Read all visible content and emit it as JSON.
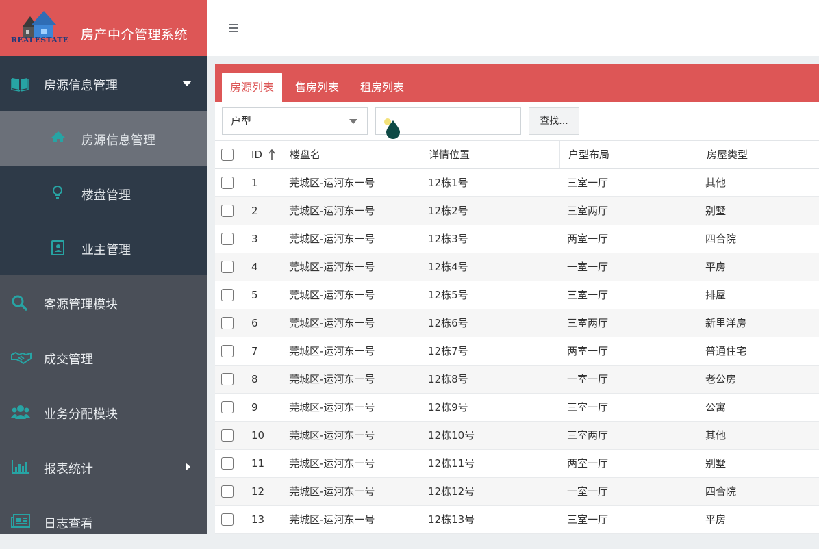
{
  "app": {
    "title": "房产中介管理系统",
    "logo_text": "REALESTATE"
  },
  "sidebar": {
    "items": [
      {
        "label": "房源信息管理",
        "icon": "book-icon",
        "expanded": true
      },
      {
        "label": "房源信息管理",
        "icon": "home-icon",
        "sub": true,
        "active": true
      },
      {
        "label": "楼盘管理",
        "icon": "lightbulb-icon",
        "sub": true
      },
      {
        "label": "业主管理",
        "icon": "contact-card-icon",
        "sub": true
      },
      {
        "label": "客源管理模块",
        "icon": "search-icon"
      },
      {
        "label": "成交管理",
        "icon": "handshake-icon"
      },
      {
        "label": "业务分配模块",
        "icon": "users-icon"
      },
      {
        "label": "报表统计",
        "icon": "bar-chart-icon",
        "has_children": true
      },
      {
        "label": "日志查看",
        "icon": "newspaper-icon"
      }
    ]
  },
  "tabs": [
    {
      "label": "房源列表",
      "active": true
    },
    {
      "label": "售房列表"
    },
    {
      "label": "租房列表"
    }
  ],
  "filter": {
    "select_value": "户型",
    "search_value": "",
    "search_button": "查找..."
  },
  "table": {
    "columns": [
      "ID",
      "楼盘名",
      "详情位置",
      "户型布局",
      "房屋类型"
    ],
    "sort_column": "ID",
    "rows": [
      [
        "1",
        "莞城区-运河东一号",
        "12栋1号",
        "三室一厅",
        "其他"
      ],
      [
        "2",
        "莞城区-运河东一号",
        "12栋2号",
        "三室两厅",
        "别墅"
      ],
      [
        "3",
        "莞城区-运河东一号",
        "12栋3号",
        "两室一厅",
        "四合院"
      ],
      [
        "4",
        "莞城区-运河东一号",
        "12栋4号",
        "一室一厅",
        "平房"
      ],
      [
        "5",
        "莞城区-运河东一号",
        "12栋5号",
        "三室一厅",
        "排屋"
      ],
      [
        "6",
        "莞城区-运河东一号",
        "12栋6号",
        "三室两厅",
        "新里洋房"
      ],
      [
        "7",
        "莞城区-运河东一号",
        "12栋7号",
        "两室一厅",
        "普通住宅"
      ],
      [
        "8",
        "莞城区-运河东一号",
        "12栋8号",
        "一室一厅",
        "老公房"
      ],
      [
        "9",
        "莞城区-运河东一号",
        "12栋9号",
        "三室一厅",
        "公寓"
      ],
      [
        "10",
        "莞城区-运河东一号",
        "12栋10号",
        "三室两厅",
        "其他"
      ],
      [
        "11",
        "莞城区-运河东一号",
        "12栋11号",
        "两室一厅",
        "别墅"
      ],
      [
        "12",
        "莞城区-运河东一号",
        "12栋12号",
        "一室一厅",
        "四合院"
      ],
      [
        "13",
        "莞城区-运河东一号",
        "12栋13号",
        "三室一厅",
        "平房"
      ]
    ]
  },
  "colors": {
    "brand": "#dd5656",
    "sidebar_bg": "#4a4f58",
    "sidebar_group_bg": "#2e3a48",
    "sidebar_active_bg": "#6b7079",
    "icon_accent": "#27a4a4"
  }
}
